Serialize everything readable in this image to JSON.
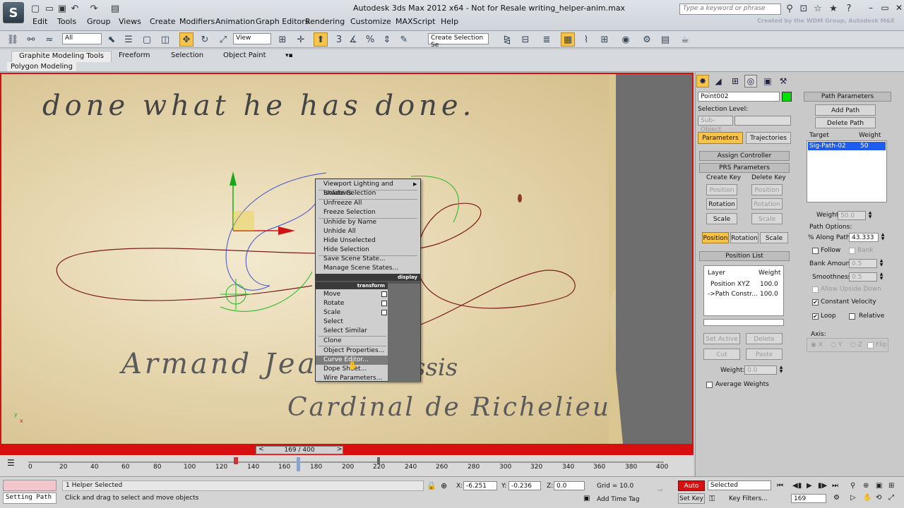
{
  "app": {
    "logo": "S",
    "title": "Autodesk 3ds Max  2012 x64    -  Not for Resale    writing_helper-anim.max",
    "search_placeholder": "Type a keyword or phrase",
    "credit": "Created by the WDM Group, Autodesk M&E"
  },
  "menu": [
    "Edit",
    "Tools",
    "Group",
    "Views",
    "Create",
    "Modifiers",
    "Animation",
    "Graph Editors",
    "Rendering",
    "Customize",
    "MAXScript",
    "Help"
  ],
  "toolbar": {
    "selection_filter": "All",
    "reference_coord": "View",
    "named_selection": "Create Selection Se",
    "snap_value": "3"
  },
  "ribbon": {
    "tabs": [
      "Graphite Modeling Tools",
      "Freeform",
      "Selection",
      "Object Paint"
    ],
    "sub": "Polygon Modeling"
  },
  "viewport": {
    "quote": "done  what  he  has  done.",
    "signature_name": "Armand Jean",
    "signature_suffix": "lessis",
    "signature_title": "Cardinal de Richelieu",
    "axis_y": "y",
    "axis_x": "x"
  },
  "quad_menu": {
    "display_header": "display",
    "transform_header": "transform",
    "display_items": [
      "Viewport Lighting and Shadows",
      "Isolate Selection",
      "Unfreeze All",
      "Freeze Selection",
      "Unhide by Name",
      "Unhide All",
      "Hide Unselected",
      "Hide Selection",
      "Save Scene State...",
      "Manage Scene States..."
    ],
    "transform_items": [
      "Move",
      "Rotate",
      "Scale",
      "Select",
      "Select Similar",
      "Clone",
      "Object Properties...",
      "Curve Editor...",
      "Dope Sheet...",
      "Wire Parameters..."
    ],
    "submenu_arrow": "▶"
  },
  "timeline": {
    "slider_label": "169 / 400",
    "ticks": [
      "0",
      "20",
      "40",
      "60",
      "80",
      "100",
      "120",
      "140",
      "160",
      "180",
      "200",
      "220",
      "240",
      "260",
      "280",
      "300",
      "320",
      "340",
      "360",
      "380",
      "400"
    ]
  },
  "cmd_panel": {
    "object_name": "Point002",
    "selection_level_label": "Selection Level:",
    "sub_object_label": "Sub-Object",
    "tab_parameters": "Parameters",
    "tab_trajectories": "Trajectories",
    "assign_controller": "Assign Controller",
    "prs_parameters": "PRS Parameters",
    "create_key_label": "Create Key",
    "delete_key_label": "Delete Key",
    "position": "Position",
    "rotation": "Rotation",
    "scale": "Scale",
    "position_list": "Position List",
    "layer_header": "Layer",
    "weight_header": "Weight",
    "layers": [
      {
        "name": "Position XYZ",
        "weight": "100.0"
      },
      {
        "name": "->Path Constr...",
        "weight": "100.0"
      }
    ],
    "set_active": "Set Active",
    "delete": "Delete",
    "cut": "Cut",
    "paste": "Paste",
    "weight_label": "Weight:",
    "weight_value": "0.0",
    "average_weights": "Average Weights",
    "path_parameters": "Path Parameters",
    "add_path": "Add Path",
    "delete_path": "Delete Path",
    "target_header": "Target",
    "target_weight_header": "Weight",
    "target_name": "Sig-Path-02",
    "target_weight": "50",
    "weight2_label": "Weight",
    "weight2_value": "50.0",
    "path_options_label": "Path Options:",
    "along_path_label": "% Along Path:",
    "along_path_value": "43.333",
    "follow": "Follow",
    "bank": "Bank",
    "bank_amount_label": "Bank Amount:",
    "bank_amount_value": "0.5",
    "smoothness_label": "Smoothness:",
    "smoothness_value": "0.5",
    "allow_upside_down": "Allow Upside Down",
    "constant_velocity": "Constant Velocity",
    "loop": "Loop",
    "relative": "Relative",
    "axis_label": "Axis:",
    "axis_x": "X",
    "axis_y": "Y",
    "axis_z": "Z",
    "flip": "Flip"
  },
  "status": {
    "listener_label": "",
    "macro": "Setting Path",
    "selected": "1 Helper Selected",
    "prompt": "Click and drag to select and move objects",
    "x_label": "X:",
    "x_value": "-6.251",
    "y_label": "Y:",
    "y_value": "-0.236",
    "z_label": "Z:",
    "z_value": "0.0",
    "grid": "Grid = 10.0",
    "add_time_tag": "Add Time Tag",
    "auto_key": "Auto Key",
    "set_key": "Set Key",
    "selected_set": "Selected",
    "key_filters": "Key Filters...",
    "current_frame": "169"
  },
  "colors": {
    "accent": "#f6c44a",
    "viewport_border": "#d80f0f",
    "object_color": "#00e000",
    "selection_blue": "#1e5cf0"
  }
}
